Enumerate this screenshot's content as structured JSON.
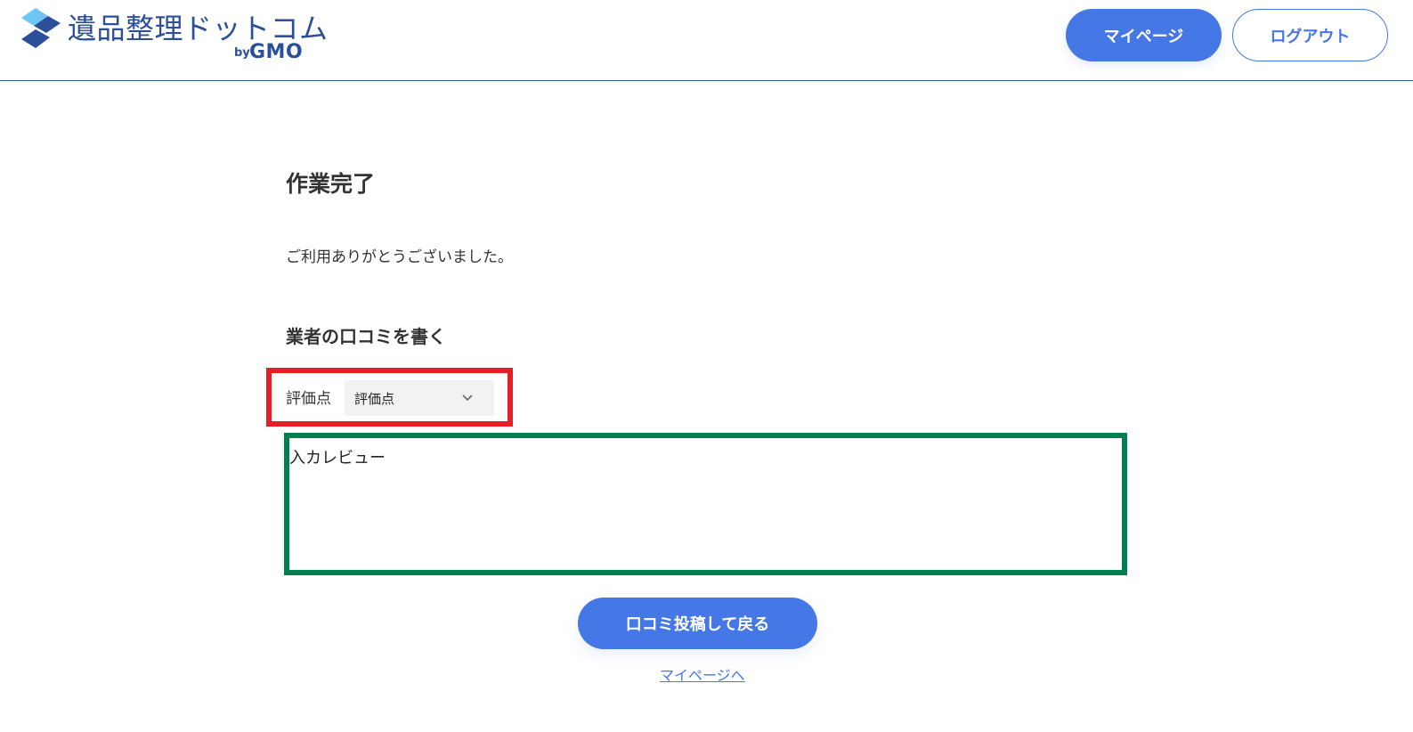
{
  "header": {
    "logo_text": "遺品整理ドットコム",
    "logo_by": "by",
    "logo_brand": "GMO",
    "mypage_button": "マイページ",
    "logout_button": "ログアウト"
  },
  "main": {
    "title": "作業完了",
    "thanks_message": "ご利用ありがとうございました。",
    "review_heading": "業者の口コミを書く",
    "rating": {
      "label": "評価点",
      "selected_value": "評価点"
    },
    "review_text": "入カレビュー",
    "submit_button": "口コミ投稿して戻る",
    "mypage_link": "マイページへ"
  },
  "colors": {
    "brand_blue": "#4577e6",
    "logo_navy": "#2c4f99",
    "logo_light": "#6ec6f5",
    "highlight_red": "#e51f25",
    "highlight_green": "#007f52"
  }
}
